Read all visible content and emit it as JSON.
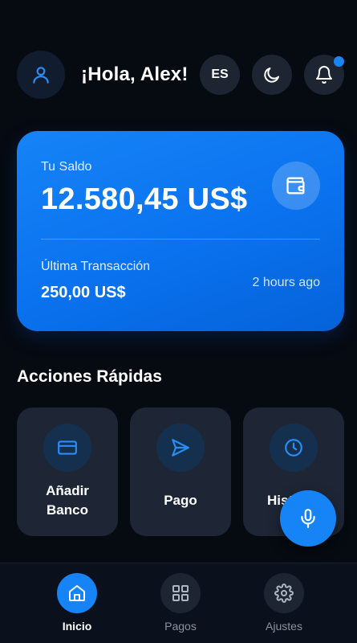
{
  "header": {
    "greeting": "¡Hola, Alex!",
    "language_label": "ES",
    "notification_unread": true,
    "avatar_icon": "user-icon",
    "theme_icon": "moon-icon",
    "notification_icon": "bell-icon"
  },
  "balance_card": {
    "label": "Tu Saldo",
    "amount": "12.580,45 US$",
    "wallet_icon": "wallet-icon",
    "last_transaction_label": "Última Transacción",
    "last_transaction_amount": "250,00 US$",
    "last_transaction_time": "2 hours ago"
  },
  "quick_actions": {
    "title": "Acciones Rápidas",
    "items": [
      {
        "label": "Añadir Banco",
        "line1": "Añadir",
        "line2": "Banco",
        "icon": "credit-card-icon"
      },
      {
        "label": "Pago",
        "icon": "send-icon"
      },
      {
        "label": "Historial",
        "visible_text": "Hist",
        "icon": "clock-icon"
      }
    ]
  },
  "mic_fab": {
    "icon": "microphone-icon"
  },
  "bottom_nav": {
    "items": [
      {
        "label": "Inicio",
        "icon": "home-icon",
        "active": true
      },
      {
        "label": "Pagos",
        "icon": "grid-icon",
        "active": false
      },
      {
        "label": "Ajustes",
        "icon": "gear-icon",
        "active": false
      }
    ]
  },
  "colors": {
    "background": "#060a11",
    "accent": "#1684f6",
    "card_surface": "#1e2636",
    "icon_blue": "#2b8cf7"
  }
}
